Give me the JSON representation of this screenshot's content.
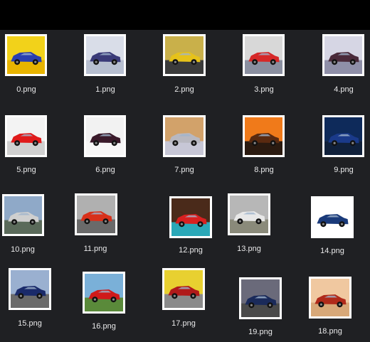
{
  "files": [
    {
      "name": "0.png",
      "sky": "#f2d21a",
      "car": "#2a3fb0",
      "ground": "#e8b400"
    },
    {
      "name": "1.png",
      "sky": "#d9dde8",
      "car": "#3a3a78",
      "ground": "#b7bfd0"
    },
    {
      "name": "2.png",
      "sky": "#c9b04a",
      "car": "#e6c21a",
      "ground": "#3b3b3b"
    },
    {
      "name": "3.png",
      "sky": "#d8d8d8",
      "car": "#d62828",
      "ground": "#8a8fa0"
    },
    {
      "name": "4.png",
      "sky": "#d6d6e4",
      "car": "#4a2a3a",
      "ground": "#8f8fa8"
    },
    {
      "name": "5.png",
      "sky": "#f3f3f3",
      "car": "#e01a1a",
      "ground": "#d0d0d0"
    },
    {
      "name": "6.png",
      "sky": "#f2f2f2",
      "car": "#3a1a2a",
      "ground": "#f7f7f7"
    },
    {
      "name": "7.png",
      "sky": "#d2a26a",
      "car": "#b8b8c0",
      "ground": "#c7c7d6"
    },
    {
      "name": "8.png",
      "sky": "#f07a1a",
      "car": "#5a2a10",
      "ground": "#2a1a10"
    },
    {
      "name": "9.png",
      "sky": "#0e2a5a",
      "car": "#1a3a8a",
      "ground": "#10203a"
    },
    {
      "name": "10.png",
      "sky": "#8fa9c8",
      "car": "#cfcfcf",
      "ground": "#5a6a5a"
    },
    {
      "name": "11.png",
      "sky": "#b0b0b0",
      "car": "#d8301a",
      "ground": "#6a6a6a"
    },
    {
      "name": "12.png",
      "sky": "#4a2a1a",
      "car": "#d82020",
      "ground": "#2aa8b8"
    },
    {
      "name": "13.png",
      "sky": "#b7b7b7",
      "car": "#e8e8e8",
      "ground": "#8a8a7a"
    },
    {
      "name": "14.png",
      "sky": "#ffffff",
      "car": "#1a3a7a",
      "ground": "#ffffff"
    },
    {
      "name": "15.png",
      "sky": "#9ab0d0",
      "car": "#1a2a6a",
      "ground": "#6a6a6a"
    },
    {
      "name": "16.png",
      "sky": "#7ab0d8",
      "car": "#d01a1a",
      "ground": "#5a8a3a"
    },
    {
      "name": "17.png",
      "sky": "#e8d030",
      "car": "#b01a1a",
      "ground": "#8a8a8a"
    },
    {
      "name": "19.png",
      "sky": "#6a6a7a",
      "car": "#1a2a5a",
      "ground": "#4a4a4a"
    },
    {
      "name": "18.png",
      "sky": "#f0c8a0",
      "car": "#b02a1a",
      "ground": "#d8a878"
    }
  ]
}
